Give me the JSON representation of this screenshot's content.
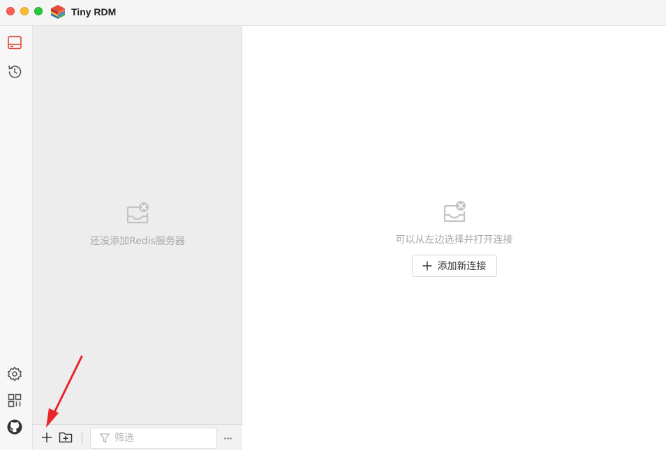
{
  "app": {
    "title": "Tiny RDM"
  },
  "titlebar": {
    "buttons": [
      "close",
      "minimize",
      "maximize"
    ]
  },
  "ribbon": {
    "top_items": [
      {
        "name": "server-icon",
        "active": true
      },
      {
        "name": "history-icon",
        "active": false
      }
    ],
    "bottom_items": [
      {
        "name": "settings-icon"
      },
      {
        "name": "apps-icon"
      },
      {
        "name": "github-icon"
      }
    ]
  },
  "connections": {
    "empty_text": "还没添加Redis服务器",
    "toolbar": {
      "add_icon": "plus-icon",
      "add_group_icon": "folder-plus-icon",
      "filter_placeholder": "筛选",
      "more_label": "···"
    }
  },
  "main": {
    "empty_text": "可以从左边选择并打开连接",
    "add_button_label": "添加新连接"
  },
  "colors": {
    "accent": "#d84a3e",
    "annotation_arrow": "#e8252b",
    "muted_text": "#a8a8a8"
  }
}
